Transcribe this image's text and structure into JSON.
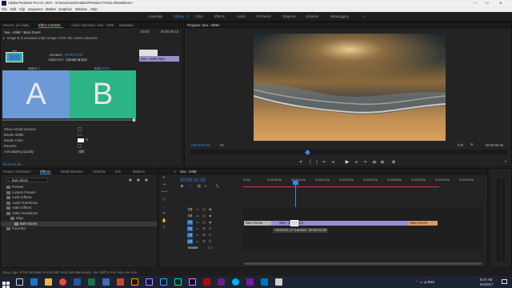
{
  "app": {
    "title": "Adobe Premiere Pro CC 2017 - E:\\Documents\\Adobe\\Premiere Pro\\11.0\\transitions *",
    "window_controls": {
      "minimize": "—",
      "maximize": "☐",
      "close": "✕"
    }
  },
  "menu": [
    "File",
    "Edit",
    "Clip",
    "Sequence",
    "Marker",
    "Graphics",
    "Window",
    "Help"
  ],
  "workspaces": {
    "items": [
      "Assembly",
      "Editing",
      "Color",
      "Effects",
      "Audio",
      "All Panels",
      "Graphics",
      "Libraries",
      "Metalogging"
    ],
    "active": "Editing",
    "menu_glyph": "≡",
    "chevron": "»"
  },
  "source_panel": {
    "tabs": [
      "Source: (no clips)",
      "Effect Controls",
      "Audio Clip Mixer: Sea - 4006",
      "Metadata"
    ],
    "active_tab": "Effect Controls",
    "clip_label": "Sea - 4006 * Barn Doors",
    "description": "Image B is revealed under image A from the center outwards.",
    "duration_label": "Duration",
    "duration_value": "00:00:01:00",
    "alignment_label": "Alignment:",
    "alignment_value": "Center at Cut",
    "start_label": "Start:",
    "start_value": "0.0",
    "end_label": "End:",
    "end_value": "100.0",
    "preview_a": "A",
    "preview_b": "B",
    "ruler_start": ":00:00",
    "ruler_mid": "00:00:00:15",
    "mini_clip_top": "",
    "mini_clip_bottom": "Sea - 4006.mp4",
    "props": [
      {
        "label": "Show Actual Sources",
        "control": "checkbox"
      },
      {
        "label": "Border Width",
        "value": "0.0"
      },
      {
        "label": "Border Color",
        "control": "color"
      },
      {
        "label": "Reverse",
        "control": "checkbox"
      },
      {
        "label": "Anti-aliasing Quality",
        "value": "Off"
      }
    ],
    "timecode": "00:00:01:25"
  },
  "program": {
    "title": "Program: Sea - 4006",
    "menu_glyph": "≡",
    "timecode_left": "+00:00:00:16",
    "fit": "Fit",
    "quality": "Full",
    "timecode_right": "00:00:00:46"
  },
  "project_panel": {
    "tabs": [
      "Project: transitions",
      "Effects",
      "Media Browser",
      "Libraries",
      "Info",
      "Markers"
    ],
    "active_tab": "Effects",
    "search_value": "barn doors",
    "tree": [
      {
        "label": "Presets",
        "indent": 0
      },
      {
        "label": "Lumetri Presets",
        "indent": 0
      },
      {
        "label": "Audio Effects",
        "indent": 0
      },
      {
        "label": "Audio Transitions",
        "indent": 0
      },
      {
        "label": "Video Effects",
        "indent": 0
      },
      {
        "label": "Video Transitions",
        "indent": 0
      },
      {
        "label": "Wipe",
        "indent": 1
      },
      {
        "label": "Barn Doors",
        "indent": 2,
        "selected": true
      },
      {
        "label": "Favorites",
        "indent": 0
      }
    ]
  },
  "timeline": {
    "title": "Sea - 4006",
    "menu_glyph": "≡",
    "timecode": "00:00:01:25",
    "ruler": [
      "00:00",
      "00:00:00:30",
      "00:00:01:00",
      "00:00:01:30",
      "00:00:02:00",
      "00:00:02:30",
      "00:00:03:00",
      "00:00:03:30",
      "00:00:04:00",
      "00:00:04:30"
    ],
    "tracks": [
      {
        "name": "V3",
        "kind": "video"
      },
      {
        "name": "V2",
        "kind": "video"
      },
      {
        "name": "V1",
        "kind": "video"
      },
      {
        "name": "A1",
        "kind": "audio"
      },
      {
        "name": "A2",
        "kind": "audio"
      },
      {
        "name": "A3",
        "kind": "audio"
      },
      {
        "name": "Master",
        "kind": "master"
      }
    ],
    "master_value": "0.0",
    "clip_left": "Barn Doors",
    "clip_main": "Sea - 4006.mp4",
    "clip_right": "Barn Doors",
    "tooltip": "-00:00:01:17 Duration: 00:00:01:00"
  },
  "status_bar": {
    "text": "Drag edge of the transition to trim both ends simultaneously. Use Shift to trim only one end."
  },
  "taskbar": {
    "time": "9:47 AM",
    "date": "9/4/2017",
    "tray": "⌃ ▭ ◂) ENG"
  },
  "colors": {
    "accent": "#2d8ceb",
    "clip_purple": "#9d8ccf",
    "clip_orange": "#d99a6a",
    "preview_a": "#6b9ad6",
    "preview_b": "#2bb587",
    "premiere": "#9999ff"
  }
}
